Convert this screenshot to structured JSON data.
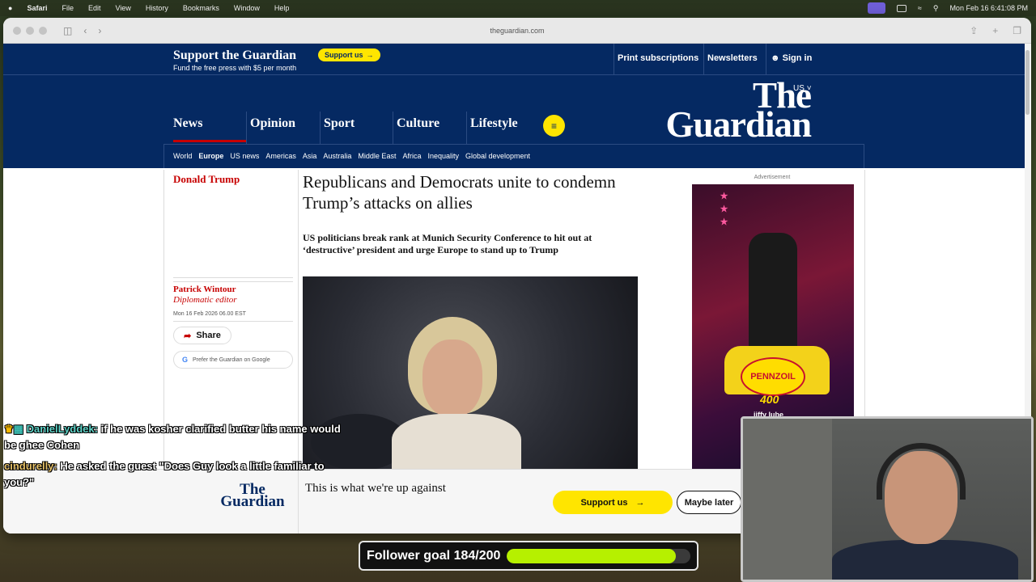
{
  "menubar": {
    "apple": "",
    "items": [
      "Safari",
      "File",
      "Edit",
      "View",
      "History",
      "Bookmarks",
      "Window",
      "Help"
    ],
    "clock": "Mon Feb 16  6:41:08 PM"
  },
  "browser": {
    "url": "theguardian.com"
  },
  "guardian": {
    "support_title": "Support the Guardian",
    "support_sub": "Fund the free press with $5 per month",
    "support_button": "Support us",
    "print_subscriptions": "Print subscriptions",
    "newsletters": "Newsletters",
    "sign_in": "Sign in",
    "region": "US",
    "logo_line1": "The",
    "logo_line2": "Guardian",
    "pillars": [
      "News",
      "Opinion",
      "Sport",
      "Culture",
      "Lifestyle"
    ],
    "subnav": [
      "World",
      "Europe",
      "US news",
      "Americas",
      "Asia",
      "Australia",
      "Middle East",
      "Africa",
      "Inequality",
      "Global development"
    ],
    "subnav_current": "Europe"
  },
  "article": {
    "kicker": "Donald Trump",
    "headline": "Republicans and Democrats unite to condemn Trump’s attacks on allies",
    "standfirst": "US politicians break rank at Munich Security Conference to hit out at ‘destructive’ president and urge Europe to stand up to Trump",
    "author": "Patrick Wintour",
    "author_role": "Diplomatic editor",
    "dateline": "Mon 16 Feb 2026 06.00 EST",
    "share": "Share",
    "google_pref": "Prefer the Guardian on Google"
  },
  "ad": {
    "label": "Advertisement",
    "brand": "PENNZOIL",
    "number": "400",
    "sponsor": "jiffy lube"
  },
  "banner": {
    "logo_line1": "The",
    "logo_line2": "Guardian",
    "text": "This is what we're up against",
    "support": "Support us",
    "later": "Maybe later"
  },
  "chat": [
    {
      "user": "DanielLyddek:",
      "message": "if he was kosher clarified butter his name would be ghee Cohen"
    },
    {
      "user": "cindurelly:",
      "message": "He asked the guest \"Does Guy look a little familiar to you?\""
    }
  ],
  "follower_goal": {
    "label": "Follower goal 184/200",
    "progress": 0.92
  },
  "colors": {
    "guardian_blue": "#052962",
    "guardian_red": "#c70000",
    "support_yellow": "#ffe500",
    "goal_green": "#b6f000"
  }
}
